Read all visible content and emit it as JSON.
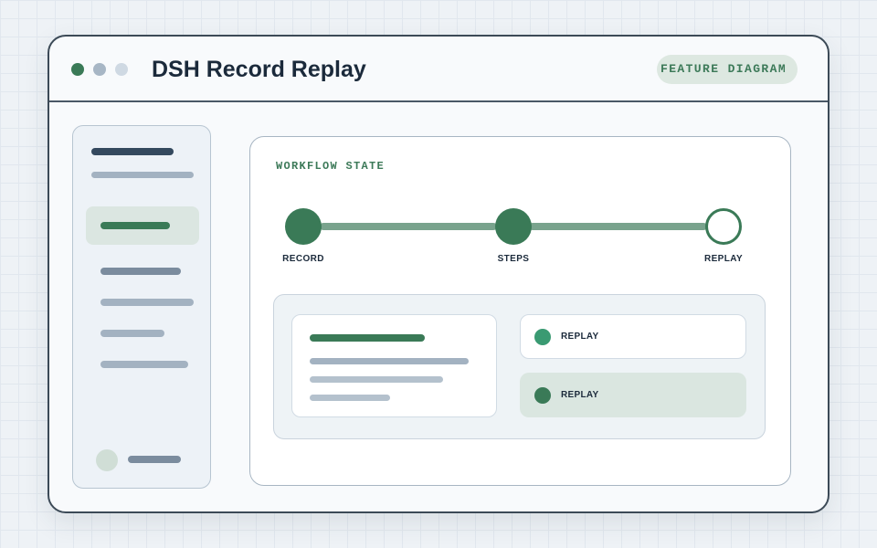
{
  "window": {
    "title": "DSH Record Replay",
    "badge": "FEATURE DIAGRAM",
    "controls": [
      {
        "name": "window-dot-1",
        "color": "#3a7a57"
      },
      {
        "name": "window-dot-2",
        "color": "#a7b6c5"
      },
      {
        "name": "window-dot-3",
        "color": "#cfd9e3"
      }
    ]
  },
  "colors": {
    "accent": "#3a7a57",
    "accent_light": "#dbe6e1",
    "connector": "#79a38d",
    "text_dark": "#1b2a3b",
    "placeholder_dark": "#34495e",
    "placeholder_mid": "#7b8c9e",
    "placeholder_light": "#a3b2c1",
    "option_dot_active": "#3a9a72"
  },
  "workflow": {
    "label": "WORKFLOW STATE",
    "steps": [
      {
        "label": "RECORD",
        "state": "complete"
      },
      {
        "label": "STEPS",
        "state": "complete"
      },
      {
        "label": "REPLAY",
        "state": "pending"
      }
    ]
  },
  "options": [
    {
      "label": "REPLAY",
      "dot_color": "#3a9a72",
      "selected": false
    },
    {
      "label": "REPLAY",
      "dot_color": "#3a7a57",
      "selected": true
    }
  ]
}
